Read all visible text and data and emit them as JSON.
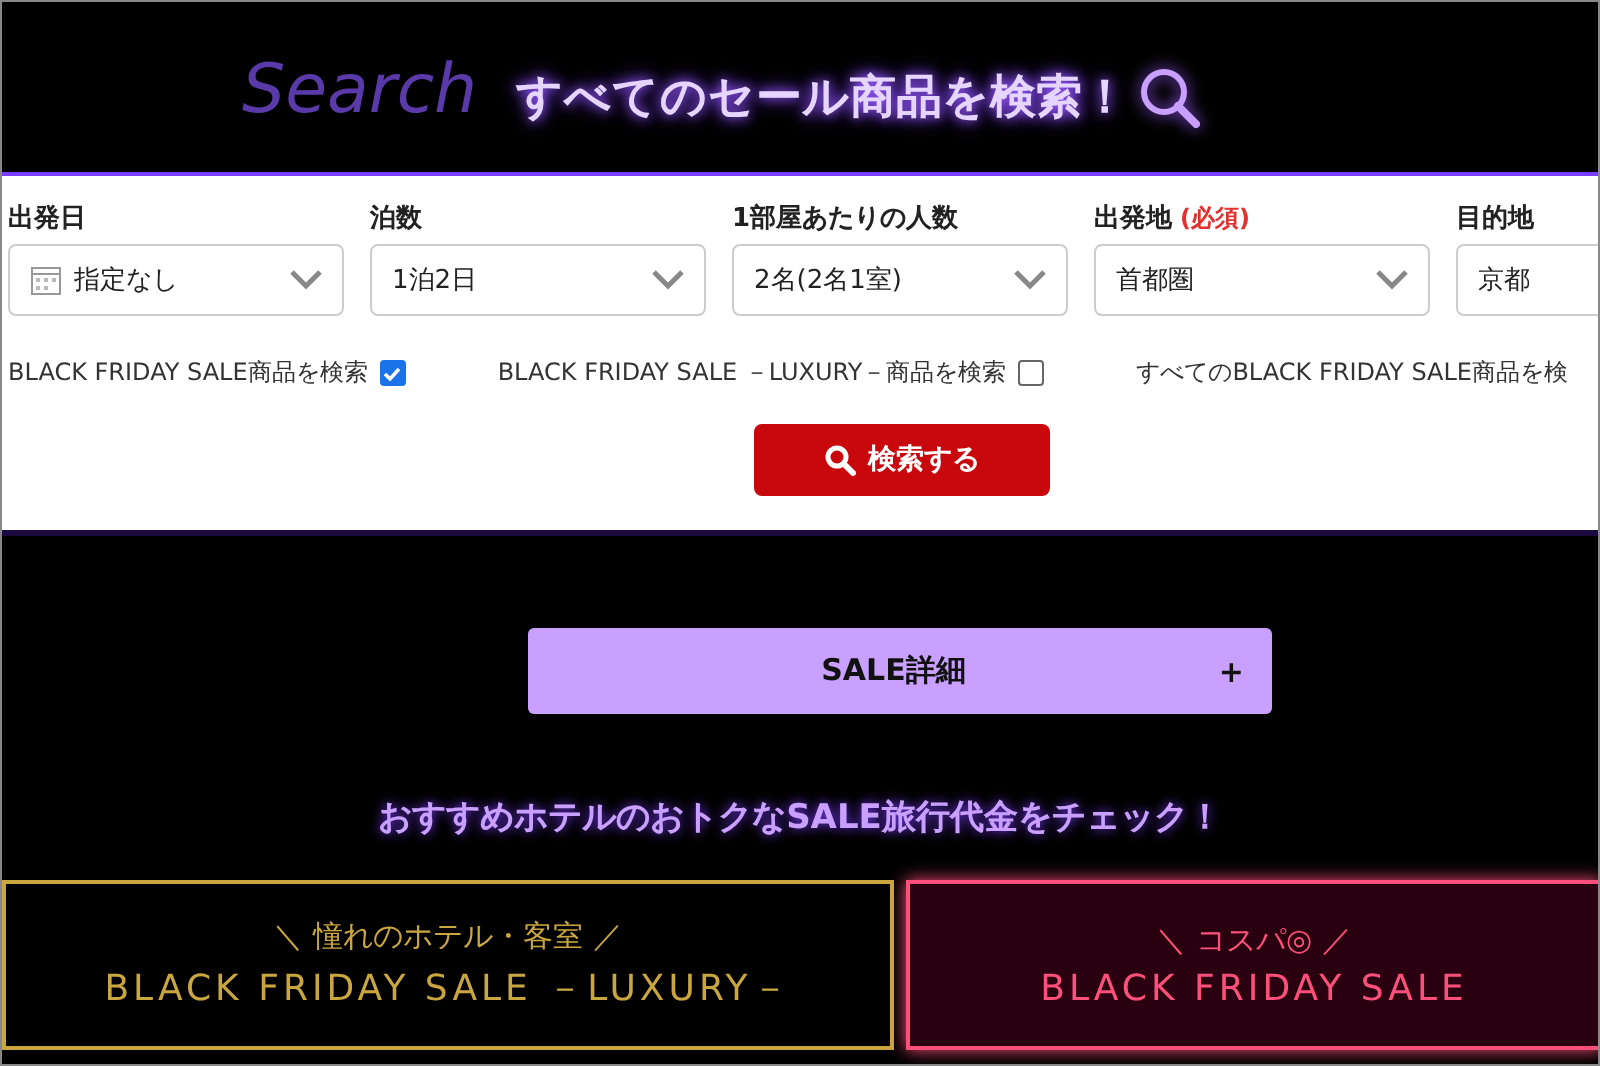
{
  "header": {
    "backdrop_word": "Search",
    "title": "すべてのセール商品を検索！"
  },
  "fields": [
    {
      "label": "出発日",
      "value": "指定なし",
      "kind": "date"
    },
    {
      "label": "泊数",
      "value": "1泊2日",
      "kind": "select"
    },
    {
      "label": "1部屋あたりの人数",
      "value": "2名(2名1室)",
      "kind": "select"
    },
    {
      "label": "出発地",
      "required_note": "(必須)",
      "value": "首都圏",
      "kind": "select"
    },
    {
      "label": "目的地",
      "value": "京都",
      "kind": "select"
    }
  ],
  "options": [
    {
      "label": "BLACK FRIDAY SALE商品を検索",
      "checked": true
    },
    {
      "label": "BLACK FRIDAY SALE －LUXURY－商品を検索",
      "checked": false
    },
    {
      "label": "すべてのBLACK FRIDAY SALE商品を検"
    }
  ],
  "search_button": "検索する",
  "details": {
    "label": "SALE詳細",
    "toggle": "+",
    "expanded": false
  },
  "tagline": "おすすめホテルのおトクなSALE旅行代金をチェック！",
  "tabs": [
    {
      "caption": "＼ 憧れのホテル・客室 ／",
      "title": "BLACK FRIDAY SALE －LUXURY－",
      "color": "#c9a640",
      "selected": false
    },
    {
      "caption": "＼ コスパ◎ ／",
      "title": "BLACK FRIDAY SALE",
      "color": "#ff4f7b",
      "selected": true
    }
  ]
}
